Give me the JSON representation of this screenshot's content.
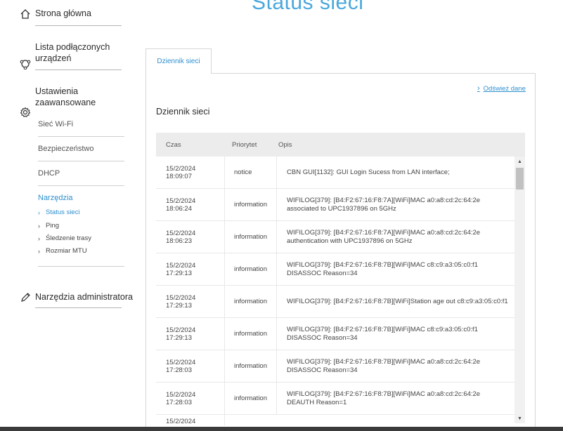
{
  "page": {
    "title": "Status sieci"
  },
  "sidebar": {
    "home": "Strona główna",
    "devices": "Lista podłączonych\nurządzeń",
    "advanced": "Ustawienia\nzaawansowane",
    "sub": [
      "Sieć Wi-Fi",
      "Bezpieczeństwo",
      "DHCP",
      "Narzędzia"
    ],
    "tools": [
      "Status sieci",
      "Ping",
      "Śledzenie trasy",
      "Rozmiar MTU"
    ],
    "admin": "Narzędzia administratora"
  },
  "tab": {
    "label": "Dziennik sieci"
  },
  "refresh": {
    "label": "Odśwież dane"
  },
  "section": {
    "title": "Dziennik sieci"
  },
  "table": {
    "headers": [
      "Czas",
      "Priorytet",
      "Opis"
    ],
    "rows": [
      {
        "time": "15/2/2024\n18:09:07",
        "priority": "notice",
        "desc": "CBN GUI[1132]: GUI Login Sucess from LAN interface;"
      },
      {
        "time": "15/2/2024\n18:06:24",
        "priority": "information",
        "desc": "WIFILOG[379]: [B4:F2:67:16:F8:7A][WiFi]MAC a0:a8:cd:2c:64:2e associated to UPC1937896 on 5GHz"
      },
      {
        "time": "15/2/2024\n18:06:23",
        "priority": "information",
        "desc": "WIFILOG[379]: [B4:F2:67:16:F8:7A][WiFi]MAC a0:a8:cd:2c:64:2e authentication with UPC1937896 on 5GHz"
      },
      {
        "time": "15/2/2024\n17:29:13",
        "priority": "information",
        "desc": "WIFILOG[379]: [B4:F2:67:16:F8:7B][WiFi]MAC c8:c9:a3:05:c0:f1 DISASSOC Reason=34"
      },
      {
        "time": "15/2/2024\n17:29:13",
        "priority": "information",
        "desc": "WIFILOG[379]: [B4:F2:67:16:F8:7B][WiFi]Station age out c8:c9:a3:05:c0:f1"
      },
      {
        "time": "15/2/2024\n17:29:13",
        "priority": "information",
        "desc": "WIFILOG[379]: [B4:F2:67:16:F8:7B][WiFi]MAC c8:c9:a3:05:c0:f1 DISASSOC Reason=34"
      },
      {
        "time": "15/2/2024\n17:28:03",
        "priority": "information",
        "desc": "WIFILOG[379]: [B4:F2:67:16:F8:7B][WiFi]MAC a0:a8:cd:2c:64:2e DISASSOC Reason=34"
      },
      {
        "time": "15/2/2024\n17:28:03",
        "priority": "information",
        "desc": "WIFILOG[379]: [B4:F2:67:16:F8:7B][WiFi]MAC a0:a8:cd:2c:64:2e DEAUTH Reason=1"
      },
      {
        "time": "15/2/2024",
        "priority": "",
        "desc": ""
      }
    ]
  },
  "colors": {
    "accent": "#2d8fd0",
    "title": "#4aa8dc"
  },
  "icons": {
    "home": "home-icon",
    "devices": "devices-icon",
    "advanced": "gear-icon",
    "admin": "pencil-icon"
  }
}
